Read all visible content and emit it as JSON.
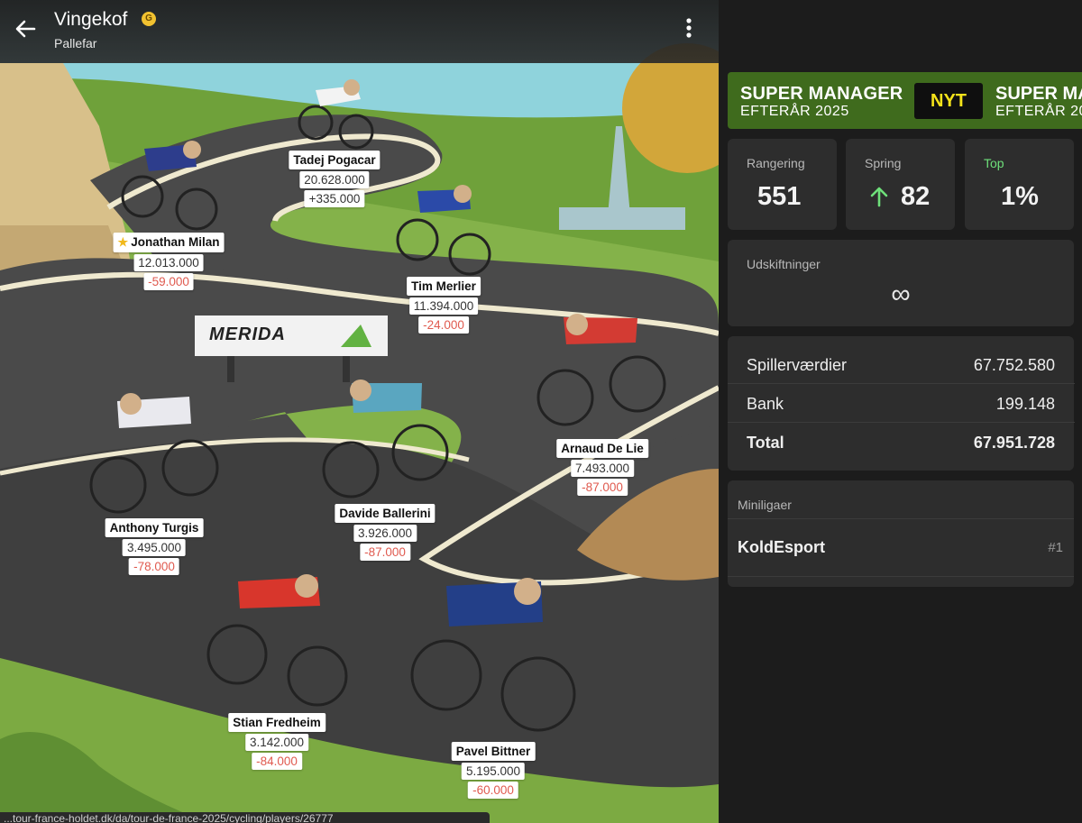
{
  "header": {
    "team_name": "Vingekof",
    "badge": "G",
    "subtitle": "Pallefar"
  },
  "sponsor": "MERIDA",
  "riders": [
    {
      "name": "Tadej Pogacar",
      "value": "20.628.000",
      "change": "+335.000",
      "change_sign": "pos",
      "captain": false
    },
    {
      "name": "Jonathan Milan",
      "value": "12.013.000",
      "change": "-59.000",
      "change_sign": "neg",
      "captain": true
    },
    {
      "name": "Tim Merlier",
      "value": "11.394.000",
      "change": "-24.000",
      "change_sign": "neg",
      "captain": false
    },
    {
      "name": "Arnaud De Lie",
      "value": "7.493.000",
      "change": "-87.000",
      "change_sign": "neg",
      "captain": false
    },
    {
      "name": "Anthony Turgis",
      "value": "3.495.000",
      "change": "-78.000",
      "change_sign": "neg",
      "captain": false
    },
    {
      "name": "Davide Ballerini",
      "value": "3.926.000",
      "change": "-87.000",
      "change_sign": "neg",
      "captain": false
    },
    {
      "name": "Stian Fredheim",
      "value": "3.142.000",
      "change": "-84.000",
      "change_sign": "neg",
      "captain": false
    },
    {
      "name": "Pavel Bittner",
      "value": "5.195.000",
      "change": "-60.000",
      "change_sign": "neg",
      "captain": false
    }
  ],
  "status_url": "...tour-france-holdet.dk/da/tour-de-france-2025/cycling/players/26777",
  "banner": {
    "line1": "SUPER MANAGER",
    "line2": "EFTERÅR 2025",
    "tag": "NYT",
    "line3": "SUPER MA",
    "line4": "EFTERÅR 20"
  },
  "stats": {
    "rank_label": "Rangering",
    "rank_value": "551",
    "jump_label": "Spring",
    "jump_value": "82",
    "top_label": "Top",
    "top_value": "1%"
  },
  "substitutions": {
    "label": "Udskiftninger",
    "value": "∞"
  },
  "finance": {
    "rows": [
      {
        "label": "Spillerværdier",
        "value": "67.752.580"
      },
      {
        "label": "Bank",
        "value": "199.148"
      },
      {
        "label": "Total",
        "value": "67.951.728"
      }
    ]
  },
  "minileagues": {
    "label": "Miniligaer",
    "items": [
      {
        "name": "KoldEsport",
        "rank": "#1"
      }
    ]
  },
  "colors": {
    "banner_green": "#3f6b1d",
    "nyt_yellow": "#f4e21a",
    "negative_red": "#e05a4f",
    "positive_green": "#6ee07a"
  }
}
